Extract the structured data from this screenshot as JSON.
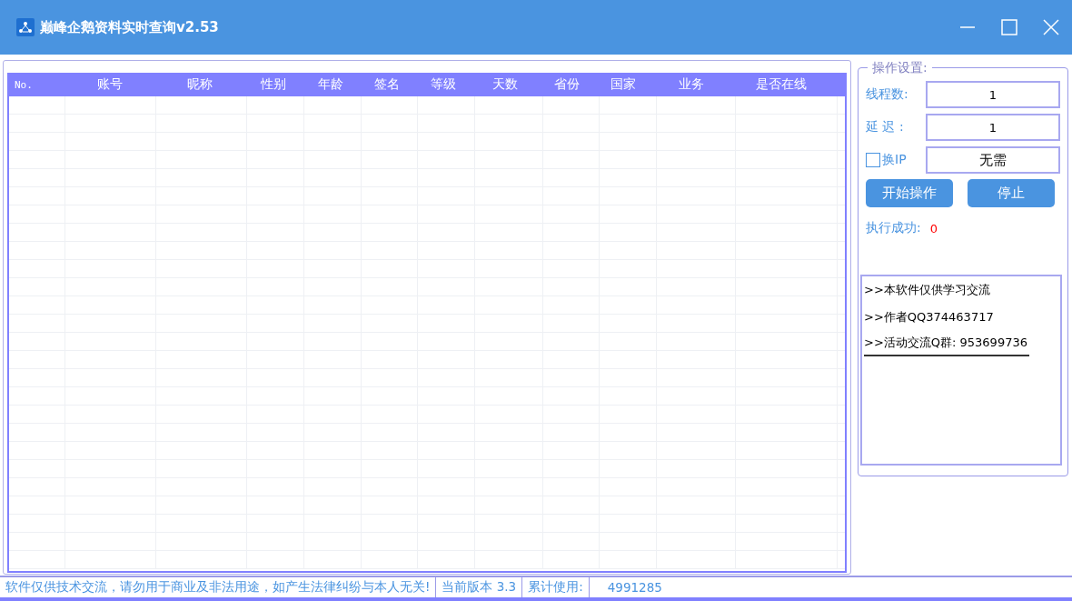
{
  "window": {
    "title": "巅峰企鹅资料实时查询v2.53"
  },
  "table": {
    "columns": [
      "No.",
      "账号",
      "昵称",
      "性别",
      "年龄",
      "签名",
      "等级",
      "天数",
      "省份",
      "国家",
      "业务",
      "是否在线"
    ]
  },
  "settings": {
    "title": "操作设置:",
    "fields": [
      {
        "label": "线程数:",
        "value": "1"
      },
      {
        "label": "延 迟 :",
        "value": "1"
      }
    ],
    "proxy": {
      "label": "换IP",
      "checked": false,
      "value": "无需"
    },
    "buttons": [
      "开始操作",
      "停止"
    ],
    "success": {
      "label": "执行成功:",
      "value": "0"
    }
  },
  "log": [
    ">>本软件仅供学习交流",
    ">>作者QQ374463717",
    ">>活动交流Q群: 953699736"
  ],
  "status_bar": [
    "软件仅供技术交流，请勿用于商业及非法用途，如产生法律纠纷与本人无关!",
    "当前版本 3.3",
    "累计使用:",
    "4991285"
  ]
}
